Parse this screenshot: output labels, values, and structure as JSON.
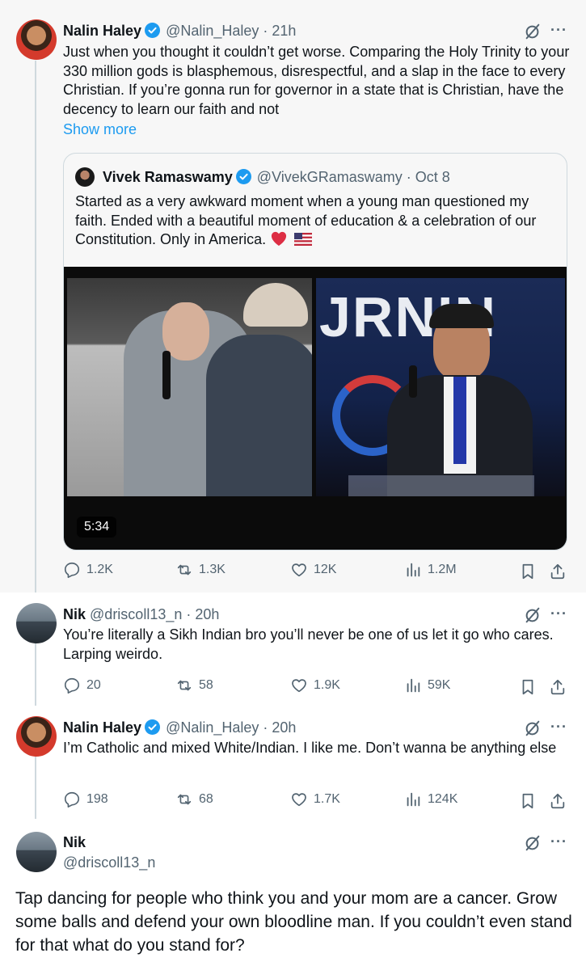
{
  "tweets": [
    {
      "name": "Nalin Haley",
      "handle": "@Nalin_Haley",
      "time": "· 21h",
      "text": "Just when you thought it couldn’t get worse. Comparing the Holy Trinity to your 330 million gods is blasphemous, disrespectful, and a slap in the face to every Christian. If you’re gonna run for governor in a state that is Christian, have the decency to learn our faith and not",
      "show_more": "Show more",
      "quote": {
        "name": "Vivek Ramaswamy",
        "handle": "@VivekGRamaswamy",
        "time": "· Oct 8",
        "text": "Started as a very awkward moment when a young man questioned my faith. Ended with a beautiful moment of education & a celebration of our Constitution. Only in America.",
        "emoji": "❤️ 🇺🇸",
        "video_duration": "5:34"
      },
      "stats": {
        "replies": "1.2K",
        "reposts": "1.3K",
        "likes": "12K",
        "views": "1.2M"
      }
    },
    {
      "name": "Nik",
      "handle": "@driscoll13_n",
      "time": "· 20h",
      "text": "You’re literally a Sikh Indian bro you’ll never be one of us let it go who cares. Larping weirdo.",
      "stats": {
        "replies": "20",
        "reposts": "58",
        "likes": "1.9K",
        "views": "59K"
      }
    },
    {
      "name": "Nalin Haley",
      "handle": "@Nalin_Haley",
      "time": "· 20h",
      "text": "I’m Catholic and mixed White/Indian. I like me. Don’t wanna be anything else",
      "stats": {
        "replies": "198",
        "reposts": "68",
        "likes": "1.7K",
        "views": "124K"
      }
    },
    {
      "name": "Nik",
      "handle": "@driscoll13_n",
      "text": "Tap dancing for people who think you and your mom are a cancer. Grow some balls and defend your own bloodline man. If you couldn’t even stand for that what do you stand for?"
    }
  ],
  "more_glyph": "···",
  "colors": {
    "accent": "#1d9bf0",
    "secondary_text": "#536471",
    "background_highlight": "#f7f7f7",
    "border": "#cfd9de"
  },
  "icons": [
    "verified-badge-icon",
    "grok-icon",
    "more-icon",
    "reply-icon",
    "repost-icon",
    "like-icon",
    "views-icon",
    "bookmark-icon",
    "share-icon",
    "heart-emoji",
    "us-flag-emoji"
  ]
}
